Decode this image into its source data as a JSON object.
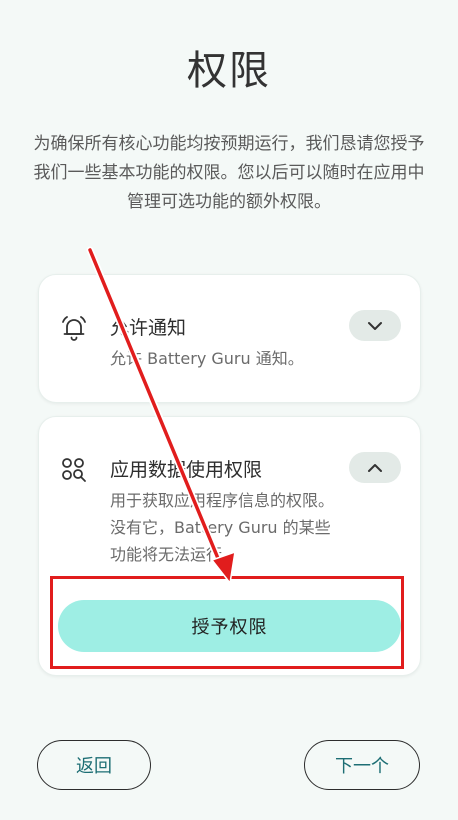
{
  "page": {
    "title": "权限",
    "description": "为确保所有核心功能均按预期运行，我们恳请您授予我们一些基本功能的权限。您以后可以随时在应用中管理可选功能的额外权限。"
  },
  "permissions": [
    {
      "title": "允许通知",
      "subtitle": "允许 Battery Guru 通知。",
      "icon": "bell-icon",
      "expanded": false
    },
    {
      "title": "应用数据使用权限",
      "subtitle": "用于获取应用程序信息的权限。没有它，Battery Guru 的某些功能将无法运行。",
      "icon": "apps-search-icon",
      "expanded": true,
      "action_label": "授予权限"
    }
  ],
  "footer": {
    "back_label": "返回",
    "next_label": "下一个"
  },
  "colors": {
    "background": "#f4f9f7",
    "accent_button": "#9eeee4",
    "link_text": "#1d6e74",
    "annotation_red": "#e11d1d"
  }
}
